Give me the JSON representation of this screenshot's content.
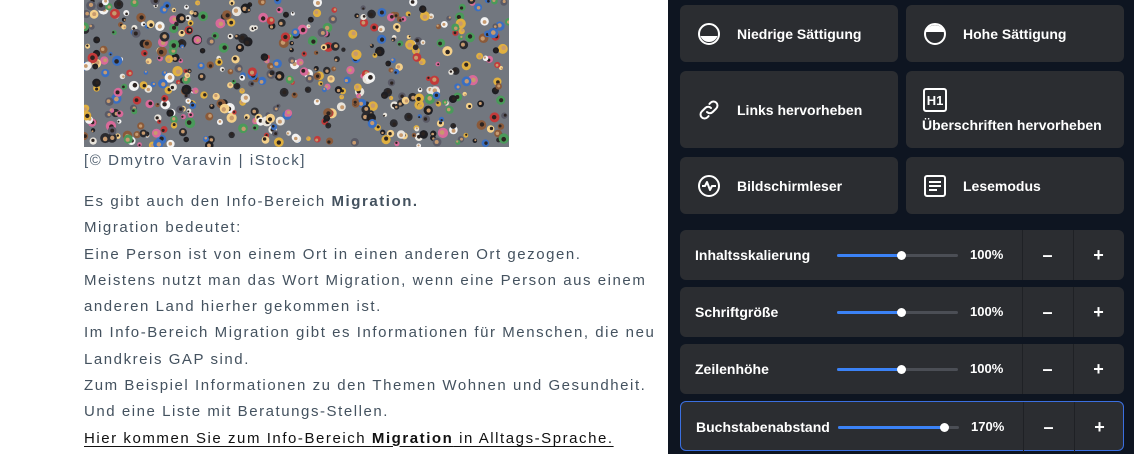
{
  "article": {
    "photo_credit": "[© Dmytro Varavin | iStock]",
    "p1_text": "Es gibt auch den Info-Bereich ",
    "p1_bold": "Migration.",
    "lines": [
      "Migration bedeutet:",
      "Eine Person ist von einem Ort in einen anderen Ort gezogen.",
      "Meistens nutzt man das Wort Migration, wenn eine Person aus einem",
      "anderen Land hierher gekommen ist.",
      "Im Info-Bereich Migration gibt es Informationen für Menschen, die neu",
      "Landkreis GAP sind.",
      "Zum Beispiel Informationen zu den Themen Wohnen und Gesundheit.",
      "Und eine Liste mit Beratungs-Stellen."
    ],
    "link_pre": "Hier kommen Sie zum Info-Bereich ",
    "link_bold": "Migration",
    "link_post": " in Alltags-Sprache."
  },
  "panel": {
    "tiles": {
      "low_saturation": "Niedrige Sättigung",
      "high_saturation": "Hohe Sättigung",
      "highlight_links": "Links hervorheben",
      "highlight_headings": "Überschriften hervorheben",
      "screen_reader": "Bildschirmleser",
      "reading_mode": "Lesemodus"
    },
    "sliders": [
      {
        "label": "Inhaltsskalierung",
        "value": "100%",
        "level": 0.53
      },
      {
        "label": "Schriftgröße",
        "value": "100%",
        "level": 0.53
      },
      {
        "label": "Zeilenhöhe",
        "value": "100%",
        "level": 0.53
      },
      {
        "label": "Buchstabenabstand",
        "value": "170%",
        "level": 0.88
      }
    ],
    "minus_label": "–",
    "plus_label": "+",
    "accent_color": "#3b82f6",
    "background_color": "#0e1521"
  }
}
